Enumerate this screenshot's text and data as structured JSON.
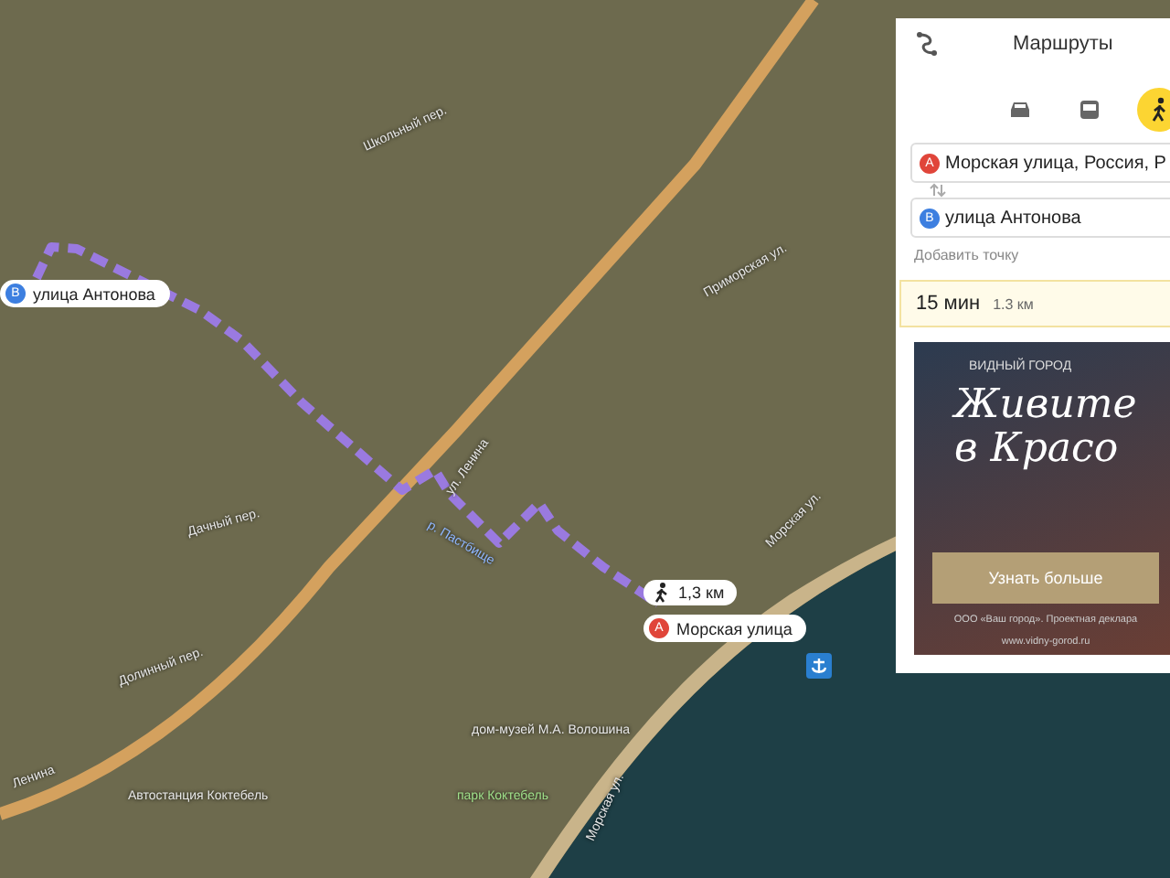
{
  "map": {
    "labels": [
      {
        "kind": "street",
        "text": "ул. Ленина"
      },
      {
        "kind": "street",
        "text": "Ленина"
      },
      {
        "kind": "street",
        "text": "Школьный пер."
      },
      {
        "kind": "street",
        "text": "Приморская ул."
      },
      {
        "kind": "street",
        "text": "Морская ул."
      },
      {
        "kind": "street",
        "text": "Морская ул."
      },
      {
        "kind": "street",
        "text": "Дачный пер."
      },
      {
        "kind": "street",
        "text": "Долинный пер."
      },
      {
        "kind": "river",
        "text": "р. Пастбище"
      },
      {
        "kind": "poi",
        "text": "Автостанция Коктебель"
      },
      {
        "kind": "poi",
        "text": "дом-музей М.А. Волошина"
      },
      {
        "kind": "park",
        "text": "парк Коктебель"
      }
    ],
    "points": [
      {
        "letter": "B",
        "text": "улица Антонова"
      },
      {
        "letter": "A",
        "text": "Морская улица"
      }
    ],
    "distance_label": "1,3 км"
  },
  "panel": {
    "title": "Маршруты",
    "modes": [
      {
        "kind": "car",
        "selected": false
      },
      {
        "kind": "bus",
        "selected": false
      },
      {
        "kind": "walk",
        "selected": true
      }
    ],
    "waypoints": [
      {
        "letter": "A",
        "text": "Морская улица, Россия, Р"
      },
      {
        "letter": "B",
        "text": "улица Антонова"
      }
    ],
    "add_point": "Добавить точку",
    "route": {
      "time": "15 мин",
      "distance": "1.3 км"
    },
    "ad": {
      "brand": "ВИДНЫЙ ГОРОД",
      "headline": "Живите в Красо",
      "button": "Узнать больше",
      "footer": "ООО «Ваш город». Проектная деклара",
      "site": "www.vidny-gorod.ru"
    }
  }
}
